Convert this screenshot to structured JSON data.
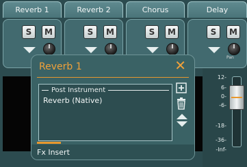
{
  "tabs": [
    {
      "label": "Reverb 1"
    },
    {
      "label": "Reverb 2"
    },
    {
      "label": "Chorus"
    },
    {
      "label": "Delay"
    }
  ],
  "strip_buttons": {
    "solo": "S",
    "mute": "M",
    "pan_label": "Pan"
  },
  "meter": {
    "ticks": [
      "12-",
      "6-",
      "0-",
      "-6-",
      "-18-",
      "-36-",
      "-Inf-"
    ]
  },
  "dialog": {
    "title": "Reverb 1",
    "close_glyph": "✕",
    "section_title": "Post Instrument",
    "fx_items": [
      "Reverb (Native)"
    ],
    "footer_label": "Fx Insert"
  },
  "colors": {
    "accent": "#e8982d",
    "panel": "#3a6265",
    "background": "#2c4b4f"
  }
}
